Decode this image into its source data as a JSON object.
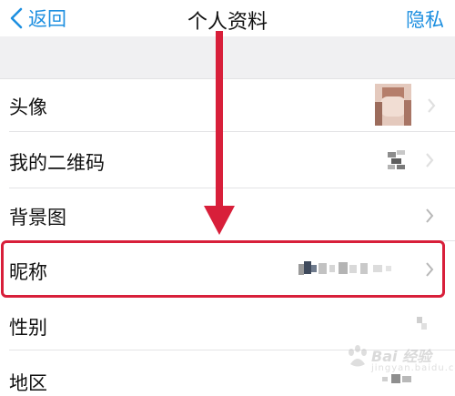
{
  "nav": {
    "back_label": "返回",
    "title": "个人资料",
    "privacy_label": "隐私"
  },
  "rows": [
    {
      "label": "头像"
    },
    {
      "label": "我的二维码"
    },
    {
      "label": "背景图"
    },
    {
      "label": "昵称"
    },
    {
      "label": "性别"
    },
    {
      "label": "地区"
    }
  ],
  "watermark": {
    "text": "Bai 经验",
    "sub": "jingyan.baidu.com"
  },
  "colors": {
    "accent": "#1d8fe0",
    "highlight": "#d81f3a"
  }
}
